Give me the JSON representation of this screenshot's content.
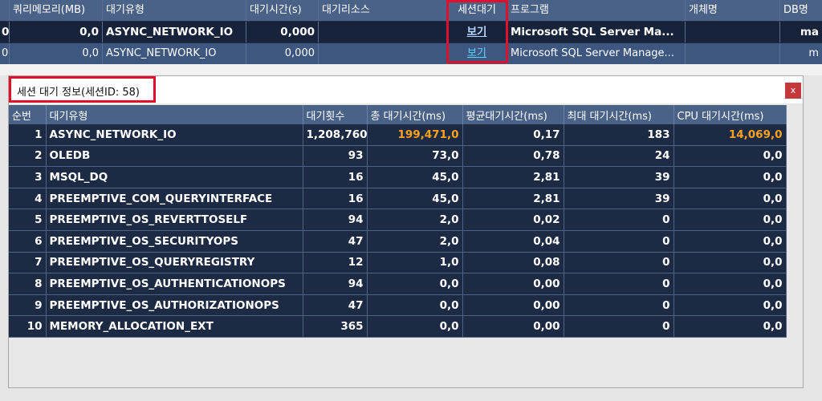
{
  "background_grid": {
    "columns": [
      "",
      "쿼리메모리(MB)",
      "대기유형",
      "대기시간(s)",
      "대기리소스",
      "세션대기",
      "프로그램",
      "개체명",
      "DB명"
    ],
    "rows": [
      [
        "0",
        "0,0",
        "ASYNC_NETWORK_IO",
        "0,000",
        "",
        "보기",
        "Microsoft SQL Server Ma...",
        "",
        "ma"
      ],
      [
        "0",
        "0,0",
        "ASYNC_NETWORK_IO",
        "0,000",
        "",
        "보기",
        "Microsoft SQL Server Manage...",
        "",
        "m"
      ]
    ]
  },
  "dialog": {
    "title": "세션 대기 정보(세션ID: 58)",
    "close_label": "x",
    "columns": [
      "순번",
      "대기유형",
      "대기횟수",
      "총 대기시간(ms)",
      "평균대기시간(ms)",
      "최대 대기시간(ms)",
      "CPU 대기시간(ms)"
    ],
    "rows": [
      [
        "1",
        "ASYNC_NETWORK_IO",
        "1,208,760",
        "199,471,0",
        "0,17",
        "183",
        "14,069,0"
      ],
      [
        "2",
        "OLEDB",
        "93",
        "73,0",
        "0,78",
        "24",
        "0,0"
      ],
      [
        "3",
        "MSQL_DQ",
        "16",
        "45,0",
        "2,81",
        "39",
        "0,0"
      ],
      [
        "4",
        "PREEMPTIVE_COM_QUERYINTERFACE",
        "16",
        "45,0",
        "2,81",
        "39",
        "0,0"
      ],
      [
        "5",
        "PREEMPTIVE_OS_REVERTTOSELF",
        "94",
        "2,0",
        "0,02",
        "0",
        "0,0"
      ],
      [
        "6",
        "PREEMPTIVE_OS_SECURITYOPS",
        "47",
        "2,0",
        "0,04",
        "0",
        "0,0"
      ],
      [
        "7",
        "PREEMPTIVE_OS_QUERYREGISTRY",
        "12",
        "1,0",
        "0,08",
        "0",
        "0,0"
      ],
      [
        "8",
        "PREEMPTIVE_OS_AUTHENTICATIONOPS",
        "94",
        "0,0",
        "0,00",
        "0",
        "0,0"
      ],
      [
        "9",
        "PREEMPTIVE_OS_AUTHORIZATIONOPS",
        "47",
        "0,0",
        "0,00",
        "0",
        "0,0"
      ],
      [
        "10",
        "MEMORY_ALLOCATION_EXT",
        "365",
        "0,0",
        "0,00",
        "0",
        "0,0"
      ]
    ],
    "highlight_color": "#ffa21a"
  },
  "annotation_color": "#e0102a"
}
